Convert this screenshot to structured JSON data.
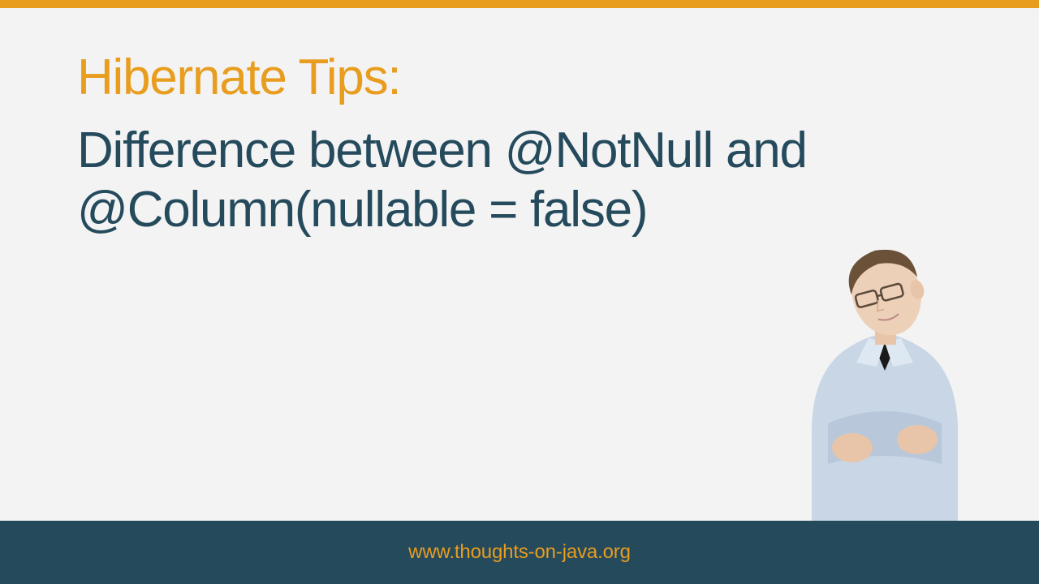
{
  "colors": {
    "accent": "#e89d1f",
    "primary": "#244a5c",
    "background": "#f3f3f3"
  },
  "title": "Hibernate Tips:",
  "subtitle": "Difference between @NotNull and @Column(nullable = false)",
  "footer": {
    "url": "www.thoughts-on-java.org"
  }
}
